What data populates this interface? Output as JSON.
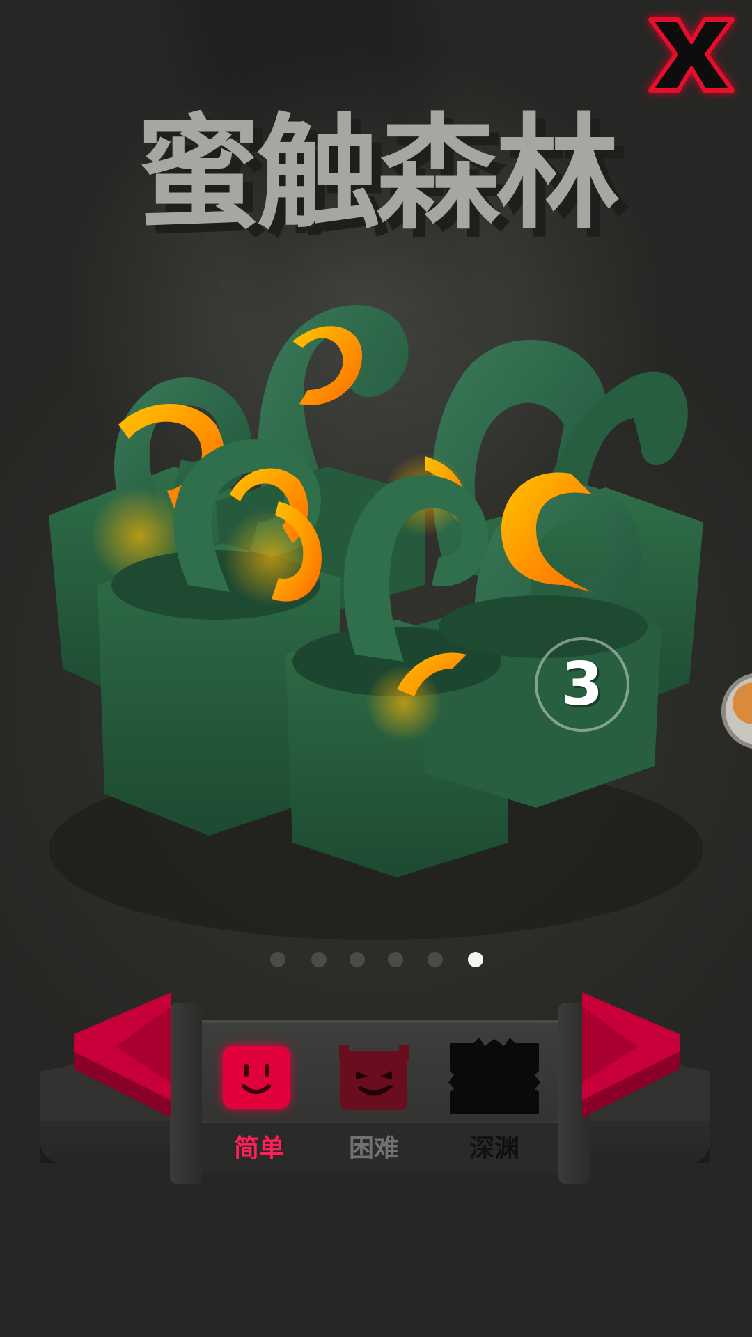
{
  "level": {
    "title": "蜜触森林",
    "number": "3"
  },
  "close_icon": "close-x-icon",
  "carousel": {
    "page_count": 6,
    "current_page": 6
  },
  "difficulty": {
    "options": [
      {
        "label": "简单",
        "icon": "smiley-face-icon",
        "selected": true,
        "color": "#ff1f5a"
      },
      {
        "label": "困难",
        "icon": "devil-face-icon",
        "selected": false,
        "color": "#727270"
      },
      {
        "label": "深渊",
        "icon": "abyss-monster-icon",
        "selected": false,
        "color": "#111111"
      }
    ],
    "prev_icon": "arrow-left-icon",
    "next_icon": "arrow-right-icon"
  },
  "colors": {
    "accent_red": "#e0003c",
    "tentacle_green": "#2c6a48",
    "glow_orange": "#ff8a00"
  }
}
